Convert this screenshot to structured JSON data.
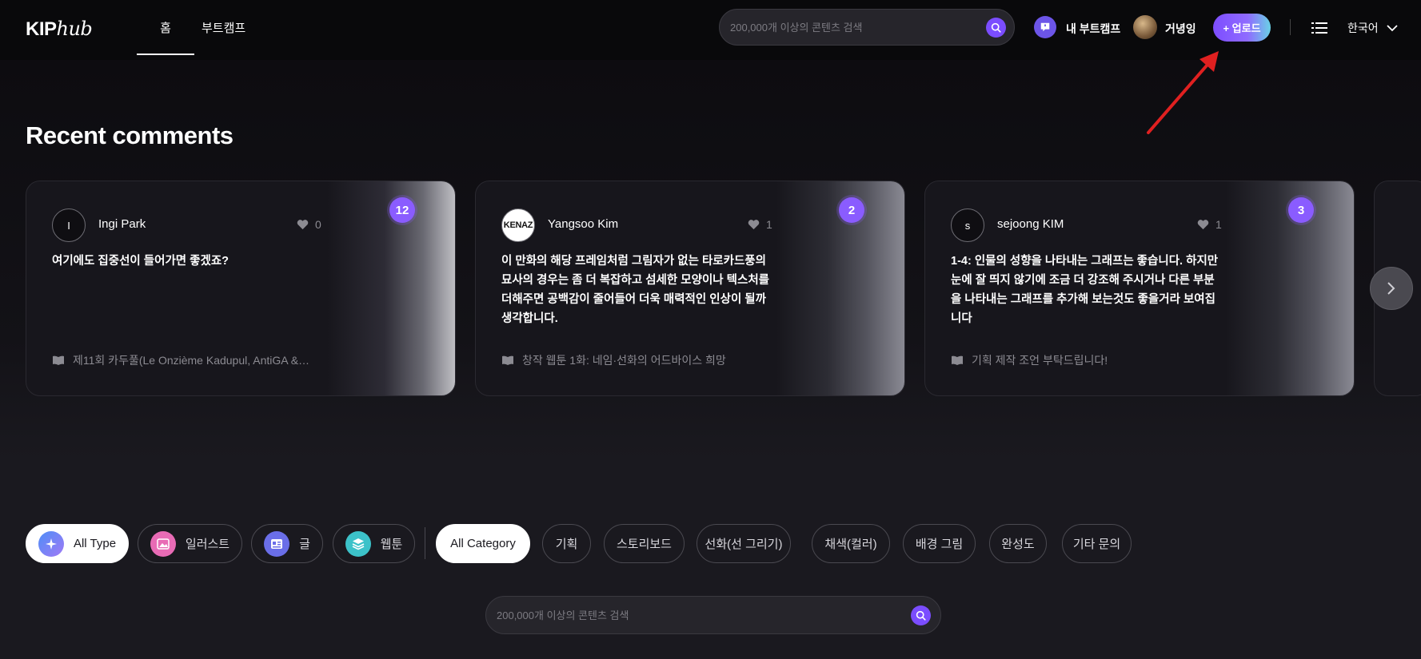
{
  "header": {
    "logo_kip": "KIP",
    "logo_hub": "hub",
    "tabs": [
      {
        "label": "홈",
        "active": true
      },
      {
        "label": "부트캠프",
        "active": false
      }
    ],
    "search_placeholder": "200,000개 이상의 콘텐츠 검색",
    "my_bootcamp_label": "내 부트캠프",
    "user_name": "거녕잉",
    "upload_label": "+ 업로드",
    "language": "한국어"
  },
  "recent": {
    "title": "Recent comments",
    "cards": [
      {
        "avatar_text": "I",
        "user": "Ingi Park",
        "likes": "0",
        "badge": "12",
        "comment": "여기에도 집중선이 들어가면 좋겠죠?",
        "ref": "제11회 카두풀(Le Onzième Kadupul, AntiGA &…"
      },
      {
        "avatar_text": "KENAZ",
        "user": "Yangsoo Kim",
        "likes": "1",
        "badge": "2",
        "comment": "이 만화의 해당 프레임처럼 그림자가 없는 타로카드풍의 묘사의 경우는 좀 더 복잡하고 섬세한 모양이나 텍스처를 더해주면 공백감이 줄어들어 더욱 매력적인 인상이 될까 생각합니다.",
        "ref": "창작 웹툰 1화: 네임·선화의 어드바이스 희망"
      },
      {
        "avatar_text": "s",
        "user": "sejoong KIM",
        "likes": "1",
        "badge": "3",
        "comment": "1-4: 인물의 성향을 나타내는 그래프는 좋습니다. 하지만 눈에 잘 띄지 않기에 조금 더 강조해 주시거나 다른 부분을 나타내는 그래프를 추가해 보는것도 좋을거라 보여집니다",
        "ref": "기획 제작 조언 부탁드립니다!"
      }
    ]
  },
  "filters": {
    "types": [
      {
        "label": "All Type",
        "active": true,
        "icon": "sparkle-icon",
        "color": "#4f8ef7"
      },
      {
        "label": "일러스트",
        "active": false,
        "icon": "image-icon",
        "color": "#e86bb5"
      },
      {
        "label": "글",
        "active": false,
        "icon": "text-icon",
        "color": "#6a6ee8"
      },
      {
        "label": "웹툰",
        "active": false,
        "icon": "layers-icon",
        "color": "#3cc2c9"
      }
    ],
    "categories": [
      {
        "label": "All Category",
        "active": true
      },
      {
        "label": "기획",
        "active": false
      },
      {
        "label": "스토리보드",
        "active": false
      },
      {
        "label": "선화(선 그리기)",
        "active": false
      },
      {
        "label": "채색(컬러)",
        "active": false
      },
      {
        "label": "배경 그림",
        "active": false
      },
      {
        "label": "완성도",
        "active": false
      },
      {
        "label": "기타 문의",
        "active": false
      }
    ]
  },
  "bottom_search_placeholder": "200,000개 이상의 콘텐츠 검색"
}
